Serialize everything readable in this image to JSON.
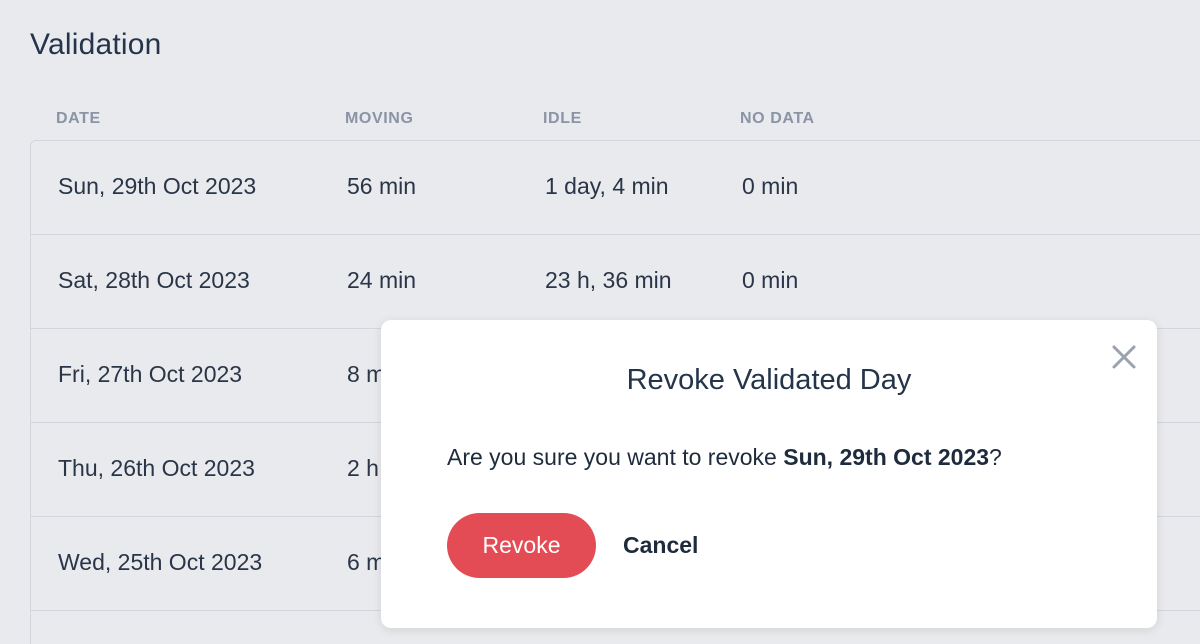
{
  "page": {
    "title": "Validation"
  },
  "table": {
    "headers": {
      "date": "DATE",
      "moving": "MOVING",
      "idle": "IDLE",
      "no_data": "NO DATA"
    },
    "rows": [
      {
        "date": "Sun, 29th Oct 2023",
        "moving": "56 min",
        "idle": "1 day, 4 min",
        "no_data": "0 min"
      },
      {
        "date": "Sat, 28th Oct 2023",
        "moving": "24 min",
        "idle": "23 h, 36 min",
        "no_data": "0 min"
      },
      {
        "date": "Fri, 27th Oct 2023",
        "moving": "8 m"
      },
      {
        "date": "Thu, 26th Oct 2023",
        "moving": "2 h"
      },
      {
        "date": "Wed, 25th Oct 2023",
        "moving": "6 m"
      }
    ]
  },
  "modal": {
    "title": "Revoke Validated Day",
    "message_prefix": "Are you sure you want to revoke ",
    "message_date": "Sun, 29th Oct 2023",
    "message_suffix": "?",
    "revoke_label": "Revoke",
    "cancel_label": "Cancel",
    "close_icon": "close-icon"
  },
  "colors": {
    "background": "#e9eaed",
    "modal_background": "#ffffff",
    "danger": "#e44c55",
    "header_text": "#8b93a6",
    "text": "#1e2b3c"
  }
}
